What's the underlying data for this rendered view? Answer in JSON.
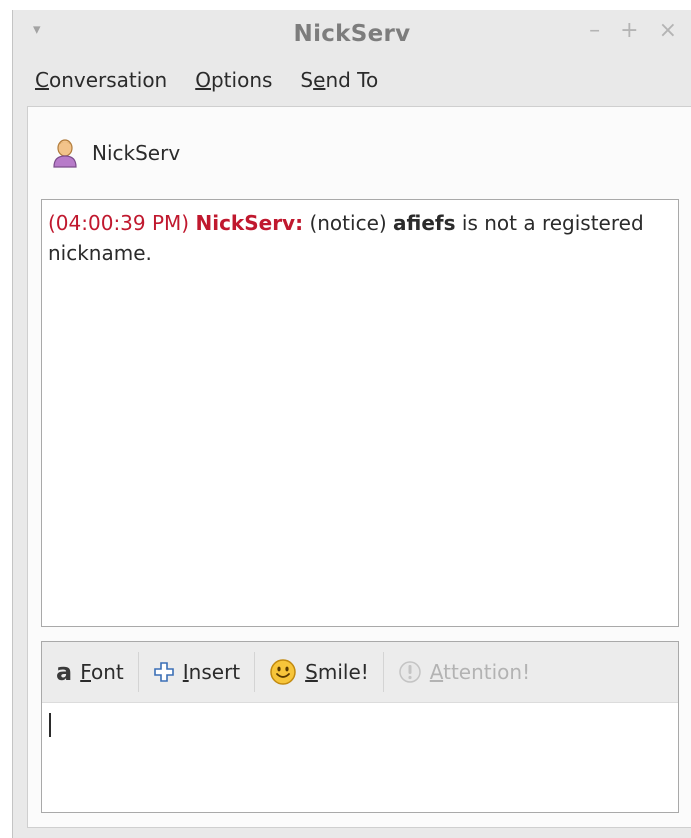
{
  "window": {
    "title": "NickServ",
    "controls": {
      "menu": "▾",
      "minimize": "–",
      "maximize": "+",
      "close": "×"
    }
  },
  "menubar": {
    "conversation": {
      "mnemonic": "C",
      "rest": "onversation"
    },
    "options": {
      "mnemonic": "O",
      "rest": "ptions"
    },
    "sendto": {
      "before": "S",
      "mnemonic": "e",
      "rest": "nd To"
    }
  },
  "header": {
    "buddy_name": "NickServ",
    "icon": "user-icon"
  },
  "log": {
    "timestamp": "(04:00:39 PM)",
    "sender": "NickServ:",
    "prefix": "(notice)",
    "nick": "afiefs",
    "message": "is not a registered nickname."
  },
  "toolbar": {
    "font": {
      "mnemonic": "F",
      "rest": "ont",
      "icon": "font-icon"
    },
    "insert": {
      "mnemonic": "I",
      "rest": "nsert",
      "icon": "insert-plus-icon"
    },
    "smile": {
      "mnemonic": "S",
      "rest": "mile!",
      "icon": "smiley-icon"
    },
    "attention": {
      "mnemonic": "A",
      "rest": "ttention!",
      "icon": "attention-icon"
    }
  },
  "input": {
    "value": ""
  },
  "colors": {
    "accent": "#c0182e",
    "window_bg": "#e9e9e9"
  }
}
